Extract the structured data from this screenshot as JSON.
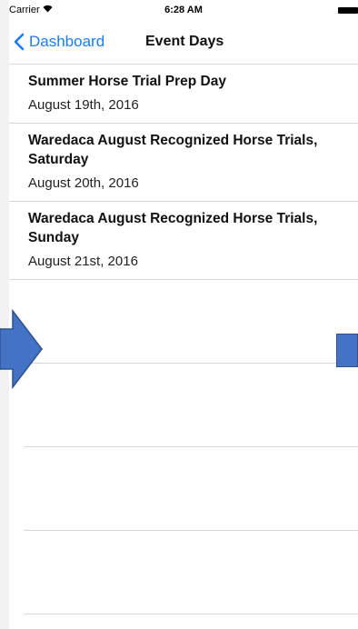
{
  "status_bar": {
    "carrier": "Carrier",
    "time": "6:28 AM",
    "wifi_icon": "wifi-icon",
    "battery_icon": "battery-icon"
  },
  "nav": {
    "back_label": "Dashboard",
    "title": "Event Days"
  },
  "events": [
    {
      "title": "Summer Horse Trial Prep Day",
      "date": "August 19th, 2016"
    },
    {
      "title": "Waredaca August Recognized Horse Trials, Saturday",
      "date": "August 20th, 2016"
    },
    {
      "title": "Waredaca August Recognized Horse Trials, Sunday",
      "date": "August 21st, 2016"
    }
  ],
  "colors": {
    "tint": "#1a7cf5",
    "overlay_fill": "#4472c4",
    "overlay_stroke": "#2f528f"
  }
}
